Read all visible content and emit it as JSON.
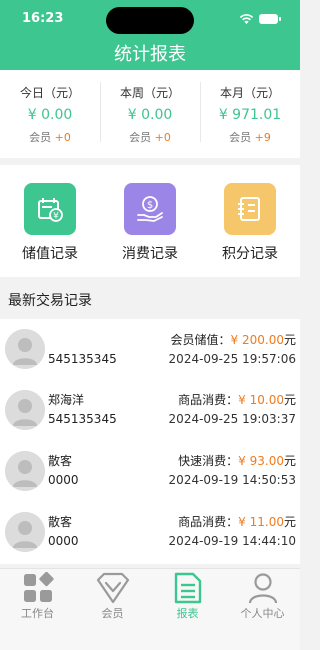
{
  "status_bar": {
    "time": "16:23"
  },
  "header": {
    "title": "统计报表"
  },
  "stats": [
    {
      "label": "今日（元）",
      "amount": "¥ 0.00",
      "member_label": "会员",
      "member_delta": "+0"
    },
    {
      "label": "本周（元）",
      "amount": "¥ 0.00",
      "member_label": "会员",
      "member_delta": "+0"
    },
    {
      "label": "本月（元）",
      "amount": "¥ 971.01",
      "member_label": "会员",
      "member_delta": "+9"
    }
  ],
  "shortcuts": [
    {
      "label": "储值记录",
      "icon": "wallet-yen-icon",
      "color": "#3ec690"
    },
    {
      "label": "消费记录",
      "icon": "hand-dollar-icon",
      "color": "#9b86e8"
    },
    {
      "label": "积分记录",
      "icon": "notebook-icon",
      "color": "#f6c76a"
    }
  ],
  "section_title": "最新交易记录",
  "transactions": [
    {
      "name": "",
      "account": "545135345",
      "type": "会员储值：",
      "amount": "¥ 200.00",
      "unit": "元",
      "datetime": "2024-09-25 19:57:06"
    },
    {
      "name": "郑海洋",
      "account": "545135345",
      "type": "商品消费：",
      "amount": "¥ 10.00",
      "unit": "元",
      "datetime": "2024-09-25 19:03:37"
    },
    {
      "name": "散客",
      "account": "0000",
      "type": "快速消费：",
      "amount": "¥ 93.00",
      "unit": "元",
      "datetime": "2024-09-19 14:50:53"
    },
    {
      "name": "散客",
      "account": "0000",
      "type": "商品消费：",
      "amount": "¥ 11.00",
      "unit": "元",
      "datetime": "2024-09-19 14:44:10"
    }
  ],
  "tabbar": [
    {
      "label": "工作台",
      "icon": "grid-icon",
      "active": false
    },
    {
      "label": "会员",
      "icon": "diamond-icon",
      "active": false
    },
    {
      "label": "报表",
      "icon": "report-icon",
      "active": true
    },
    {
      "label": "个人中心",
      "icon": "person-icon",
      "active": false
    }
  ],
  "colors": {
    "primary": "#3ec690",
    "accent": "#f07b1e"
  }
}
